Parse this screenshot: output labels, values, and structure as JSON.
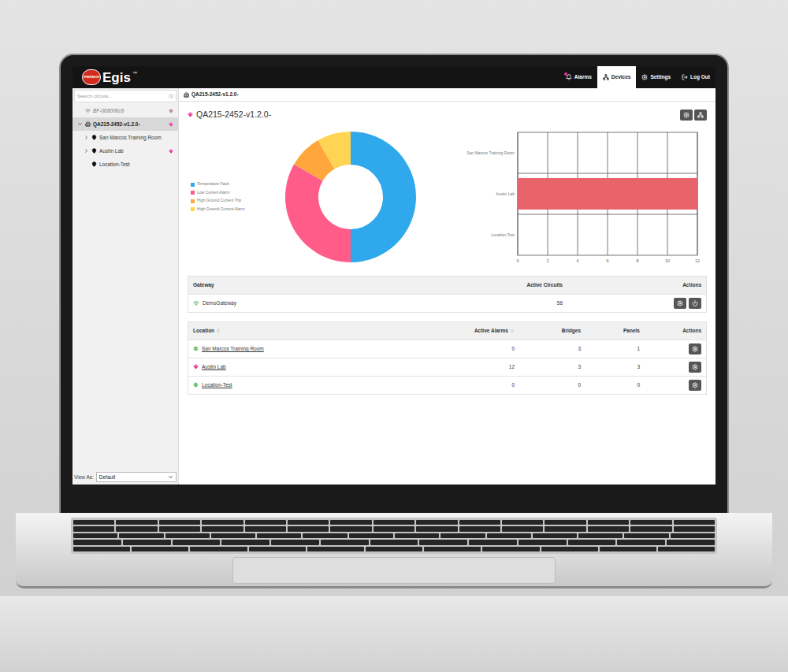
{
  "header": {
    "logo_badge": "THERMON",
    "logo": "Egis",
    "trademark": "™",
    "nav": [
      {
        "label": "Alarms",
        "kind": "alarms",
        "selected": false,
        "alert": true
      },
      {
        "label": "Devices",
        "kind": "devices",
        "selected": true,
        "alert": false
      },
      {
        "label": "Settings",
        "kind": "settings",
        "selected": false,
        "alert": false
      },
      {
        "label": "Log Out",
        "kind": "logout",
        "selected": false,
        "alert": false
      }
    ]
  },
  "sidebar": {
    "search": {
      "placeholder": "Search circuits..."
    },
    "tree": [
      {
        "label": "BF-008006c8",
        "kind": "gateway",
        "selected": false,
        "muted": true,
        "status": "offline",
        "expandable": false,
        "expanded": false,
        "children": []
      },
      {
        "label": "QA215-2452-v1.2.0-",
        "kind": "site",
        "selected": true,
        "muted": false,
        "status": "alarm",
        "expandable": true,
        "expanded": true,
        "children": [
          {
            "label": "San Marcos Training Room",
            "kind": "location",
            "selected": false,
            "muted": false,
            "status": "none",
            "expandable": true,
            "expanded": false,
            "children": []
          },
          {
            "label": "Austin Lab",
            "kind": "location",
            "selected": false,
            "muted": false,
            "status": "alarm",
            "expandable": true,
            "expanded": false,
            "children": []
          },
          {
            "label": "Location-Test",
            "kind": "location",
            "selected": false,
            "muted": false,
            "status": "none",
            "expandable": false,
            "expanded": false,
            "children": []
          }
        ]
      }
    ],
    "view_as": {
      "label": "View As:",
      "value": "Default"
    }
  },
  "breadcrumb": "QA215-2452-v1.2.0-",
  "page": {
    "title": "QA215-2452-v1.2.0-",
    "status": "alarm"
  },
  "donut_chart": {
    "series": [
      {
        "label": "Temperature Fault",
        "value": 6,
        "color": "#2fa8ec"
      },
      {
        "label": "Low Current Alarm",
        "value": 4,
        "color": "#ff5c8a"
      },
      {
        "label": "High Ground Current Trip",
        "value": 1,
        "color": "#ffa63d"
      },
      {
        "label": "High Ground Current Alarm",
        "value": 1,
        "color": "#ffd452"
      }
    ]
  },
  "bar_chart": {
    "categories": [
      "San Marcos Training Room",
      "Austin Lab",
      "Location-Test"
    ],
    "values": [
      0,
      12,
      0
    ],
    "axis_max": 12,
    "ticks": [
      "0",
      "2",
      "4",
      "6",
      "8",
      "10",
      "12"
    ]
  },
  "gateway_table": {
    "columns": [
      {
        "label": "Gateway",
        "sortable": false
      },
      {
        "label": "Active Circuits",
        "sortable": false
      },
      {
        "label": "Actions",
        "sortable": false
      }
    ],
    "rows": [
      {
        "name": "DemoGateway",
        "status": "online",
        "active_circuits": "56"
      }
    ]
  },
  "location_table": {
    "columns": [
      {
        "label": "Location",
        "sortable": true
      },
      {
        "label": "Active Alarms",
        "sortable": true
      },
      {
        "label": "Bridges",
        "sortable": false
      },
      {
        "label": "Panels",
        "sortable": false
      },
      {
        "label": "Actions",
        "sortable": false
      }
    ],
    "rows": [
      {
        "name": "San Marcos Training Room",
        "status": "ok",
        "active_alarms": "0",
        "bridges": "3",
        "panels": "1"
      },
      {
        "name": "Austin Lab",
        "status": "alarm",
        "active_alarms": "12",
        "bridges": "3",
        "panels": "3"
      },
      {
        "name": "Location-Test",
        "status": "ok",
        "active_alarms": "0",
        "bridges": "0",
        "panels": "0"
      }
    ]
  }
}
